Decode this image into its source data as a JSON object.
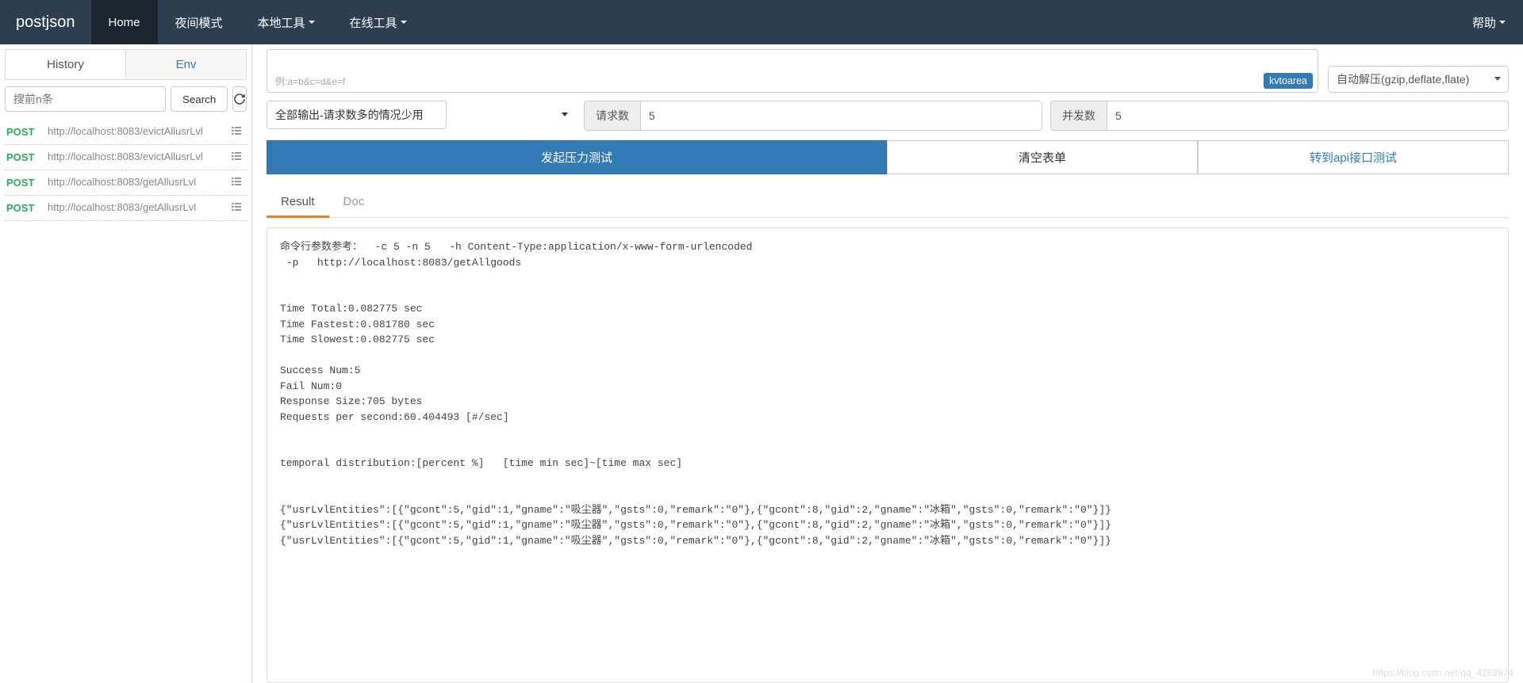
{
  "brand": "postjson",
  "nav": {
    "home": "Home",
    "night": "夜间模式",
    "local": "本地工具",
    "online": "在线工具",
    "help": "帮助"
  },
  "sidebar": {
    "tabs": {
      "history": "History",
      "env": "Env"
    },
    "search_placeholder": "搜前n条",
    "search_btn": "Search",
    "items": [
      {
        "method": "POST",
        "url": "http://localhost:8083/evictAllusrLvl"
      },
      {
        "method": "POST",
        "url": "http://localhost:8083/evictAllusrLvl"
      },
      {
        "method": "POST",
        "url": "http://localhost:8083/getAllusrLvl"
      },
      {
        "method": "POST",
        "url": "http://localhost:8083/getAllusrLvl"
      }
    ]
  },
  "body_box": {
    "example": "例:a=b&c=d&e=f",
    "kvtoarea": "kvtoarea"
  },
  "decompress_select": "自动解压(gzip,deflate,flate)",
  "output_select": "全部输出-请求数多的情况少用",
  "req_count": {
    "label": "请求数",
    "value": "5"
  },
  "concurrency": {
    "label": "并发数",
    "value": "5"
  },
  "buttons": {
    "start": "发起压力测试",
    "clear": "清空表单",
    "switch": "转到api接口测试"
  },
  "result_tabs": {
    "result": "Result",
    "doc": "Doc"
  },
  "result_text": "命令行参数参考：  -c 5 -n 5   -h Content-Type:application/x-www-form-urlencoded   \n -p   http://localhost:8083/getAllgoods\n\n\nTime Total:0.082775 sec\nTime Fastest:0.081780 sec\nTime Slowest:0.082775 sec\n\nSuccess Num:5\nFail Num:0\nResponse Size:705 bytes\nRequests per second:60.404493 [#/sec]\n\n\ntemporal distribution:[percent %]   [time min sec]~[time max sec]\n\n\n{\"usrLvlEntities\":[{\"gcont\":5,\"gid\":1,\"gname\":\"吸尘器\",\"gsts\":0,\"remark\":\"0\"},{\"gcont\":8,\"gid\":2,\"gname\":\"冰箱\",\"gsts\":0,\"remark\":\"0\"}]}\n{\"usrLvlEntities\":[{\"gcont\":5,\"gid\":1,\"gname\":\"吸尘器\",\"gsts\":0,\"remark\":\"0\"},{\"gcont\":8,\"gid\":2,\"gname\":\"冰箱\",\"gsts\":0,\"remark\":\"0\"}]}\n{\"usrLvlEntities\":[{\"gcont\":5,\"gid\":1,\"gname\":\"吸尘器\",\"gsts\":0,\"remark\":\"0\"},{\"gcont\":8,\"gid\":2,\"gname\":\"冰箱\",\"gsts\":0,\"remark\":\"0\"}]}",
  "watermark": "https://blog.csdn.net/qq_4283974"
}
